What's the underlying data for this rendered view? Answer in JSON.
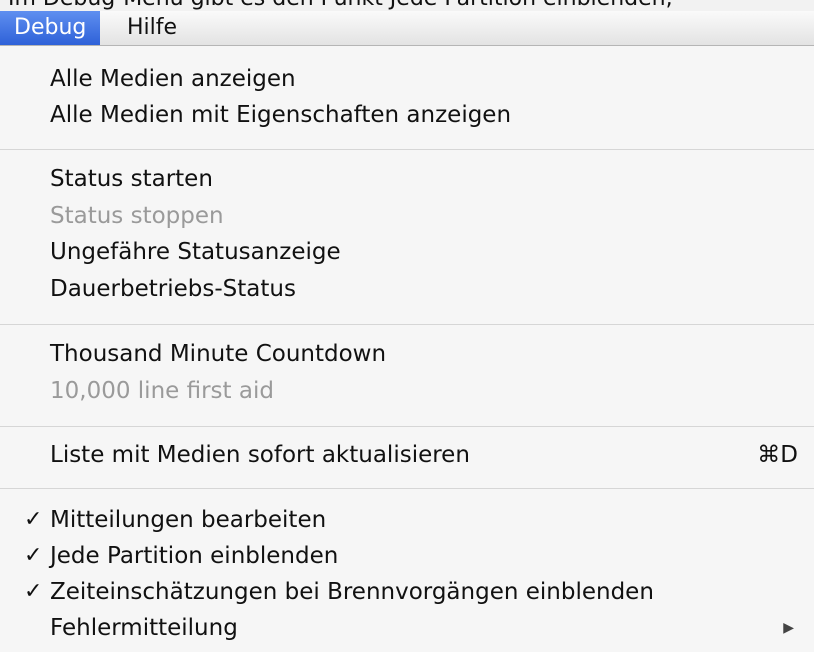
{
  "caption": "Im Debug-Menü gibt es den Punkt Jede Partition einblenden,",
  "menubar": {
    "debug": "Debug",
    "help": "Hilfe"
  },
  "menu": {
    "show_all_media": "Alle Medien anzeigen",
    "show_all_media_props": "Alle Medien mit Eigenschaften anzeigen",
    "status_start": "Status starten",
    "status_stop": "Status stoppen",
    "approx_status": "Ungefähre Statusanzeige",
    "continuous_status": "Dauerbetriebs-Status",
    "thousand_countdown": "Thousand Minute Countdown",
    "ten_thousand_first_aid": "10,000 line first aid",
    "refresh_media_list": "Liste mit Medien sofort aktualisieren",
    "refresh_shortcut": "⌘D",
    "edit_messages": "Mitteilungen bearbeiten",
    "show_each_partition": "Jede Partition einblenden",
    "show_burn_time_estimates": "Zeiteinschätzungen bei Brennvorgängen einblenden",
    "error_messages": "Fehlermitteilung",
    "checkmark": "✓",
    "submenu_arrow": "▶"
  }
}
